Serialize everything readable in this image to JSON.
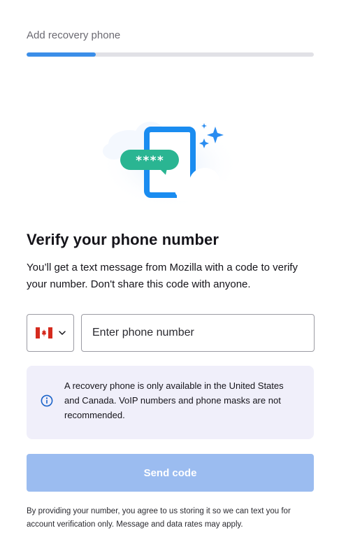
{
  "header": {
    "step_label": "Add recovery phone",
    "progress_fraction": 0.24
  },
  "illustration": {
    "bubble_text": "****",
    "icons": [
      "phone-icon",
      "message-bubble-icon",
      "cloud-icon",
      "sparkle-icon"
    ]
  },
  "main": {
    "title": "Verify your phone number",
    "description": "You’ll get a text message from Mozilla with a code to verify your number. Don't share this code with anyone."
  },
  "form": {
    "country": {
      "selected": "Canada",
      "flag_icon": "canada-flag-icon"
    },
    "phone": {
      "value": "",
      "placeholder": "Enter phone number"
    }
  },
  "info": {
    "icon": "info-icon",
    "text": "A recovery phone is only available in the United States and Canada. VoIP numbers and phone masks are not recommended."
  },
  "actions": {
    "send_label": "Send code"
  },
  "footer": {
    "disclaimer": "By providing your number, you agree to us storing it so we can text you for account verification only. Message and data rates may apply."
  },
  "colors": {
    "accent": "#3b8ee8",
    "button_disabled": "#9bbcf0",
    "info_background": "#f0effa",
    "bubble": "#2ab592"
  }
}
